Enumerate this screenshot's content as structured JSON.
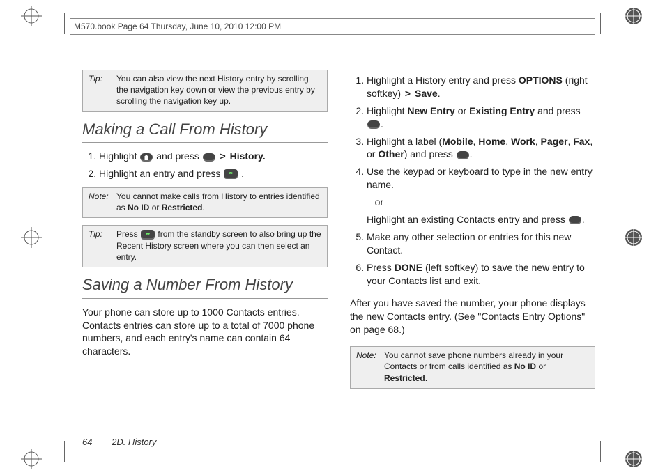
{
  "header": {
    "file_stamp": "M570.book  Page 64  Thursday, June 10, 2010  12:00 PM"
  },
  "footer": {
    "page_number": "64",
    "section": "2D. History"
  },
  "col1": {
    "tip1": {
      "label": "Tip:",
      "text": "You can also view the next History entry by scrolling the navigation key down or view the previous entry by scrolling the navigation key up."
    },
    "hdr1": "Making a Call From History",
    "step1_pre": "Highlight ",
    "step1_mid": " and press ",
    "step1_link": "History.",
    "step2_pre": "Highlight an entry and press ",
    "step2_post": ".",
    "note1": {
      "label": "Note:",
      "pre": "You cannot make calls from History to entries identified as ",
      "b1": "No ID",
      "mid": " or ",
      "b2": "Restricted",
      "post": "."
    },
    "tip2": {
      "label": "Tip:",
      "pre": "Press ",
      "post": " from the standby screen to also bring up the Recent History screen where you can then select an entry."
    },
    "hdr2": "Saving a Number From History",
    "para1": "Your phone can store up to 1000 Contacts entries. Contacts entries can store up to a total of 7000 phone numbers, and each entry's name can contain 64 characters."
  },
  "col2": {
    "s1_pre": "Highlight a History entry and press ",
    "s1_b1": "OPTIONS",
    "s1_mid": " (right softkey) ",
    "s1_gt": ">",
    "s1_b2": "Save",
    "s1_post": ".",
    "s2_pre": "Highlight ",
    "s2_b1": "New Entry",
    "s2_mid1": " or ",
    "s2_b2": "Existing Entry",
    "s2_mid2": " and press ",
    "s2_post": ".",
    "s3_pre": "Highlight a label (",
    "s3_b1": "Mobile",
    "s3_c": ", ",
    "s3_b2": "Home",
    "s3_b3": "Work",
    "s3_b4": "Pager",
    "s3_b5": "Fax",
    "s3_mid": ", or ",
    "s3_b6": "Other",
    "s3_mid2": ") and press ",
    "s3_post": ".",
    "s4": "Use the keypad or keyboard to type in the new entry name.",
    "s4_or": "– or –",
    "s4_alt_pre": "Highlight an existing Contacts entry and press ",
    "s4_alt_post": ".",
    "s5": "Make any other selection or entries for this new Contact.",
    "s6_pre": "Press ",
    "s6_b1": "DONE",
    "s6_post": " (left softkey) to save the new entry to your Contacts list and exit.",
    "para2": "After you have saved the number, your phone displays the new Contacts entry. (See \"Contacts Entry Options\" on page 68.)",
    "note2": {
      "label": "Note:",
      "pre": "You cannot save phone numbers already in your Contacts or from calls identified as ",
      "b1": "No ID",
      "mid": " or ",
      "b2": "Restricted",
      "post": "."
    }
  }
}
